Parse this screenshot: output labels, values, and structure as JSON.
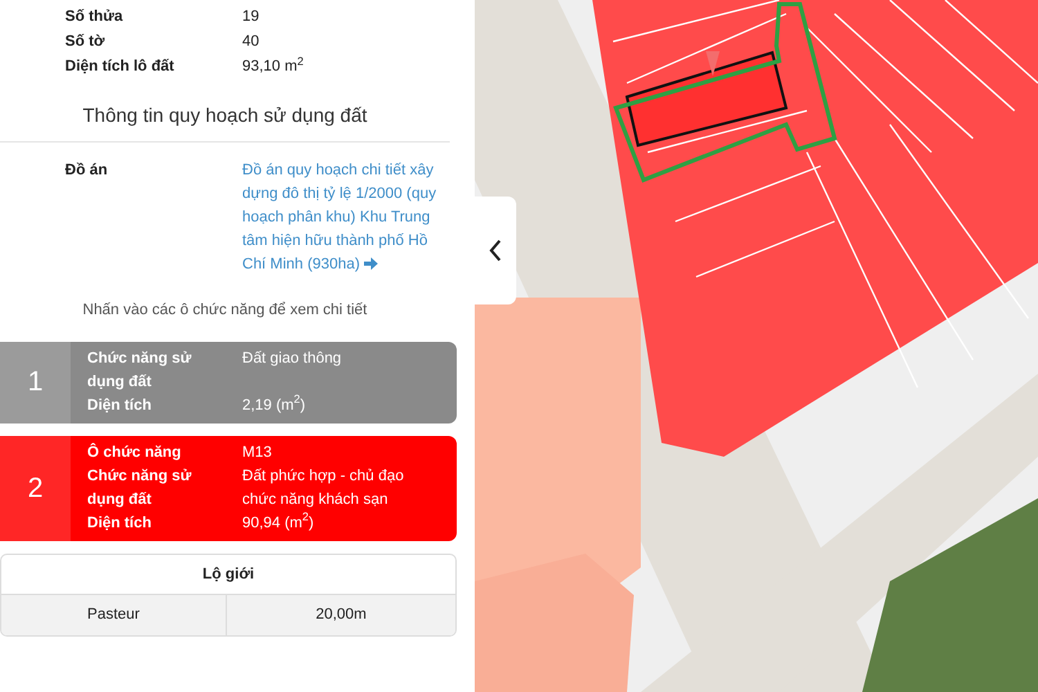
{
  "parcel_info": [
    {
      "label": "Số thửa",
      "value": "19"
    },
    {
      "label": "Số tờ",
      "value": "40"
    },
    {
      "label": "Diện tích lô đất",
      "value": "93,10 m$^{2}$"
    }
  ],
  "planning_title": "Thông tin quy hoạch sử dụng đất",
  "project": {
    "label": "Đồ án",
    "link": "Đồ án quy hoạch chi tiết xây dựng đô thị tỷ lệ 1/2000 (quy hoạch phân khu) Khu Trung tâm hiện hữu thành phố Hồ Chí Minh (930ha)"
  },
  "hint": "Nhấn vào các ô chức năng để xem chi tiết",
  "zones": [
    {
      "number": "1",
      "color": "#8a8a8a",
      "fields": [
        {
          "label": "Chức năng sử dụng đất",
          "value": "Đất giao thông"
        },
        {
          "label": "Diện tích",
          "value": "2,19 (m$^{2}$)"
        }
      ]
    },
    {
      "number": "2",
      "color": "#ff0000",
      "fields": [
        {
          "label": "Ô chức năng",
          "value": "M13"
        },
        {
          "label": "Chức năng sử dụng đất",
          "value": "Đất phức hợp - chủ đạo chức năng khách sạn"
        },
        {
          "label": "Diện tích",
          "value": "90,94 (m$^{2}$)"
        }
      ]
    }
  ],
  "road_width": {
    "title": "Lộ giới",
    "rows": [
      {
        "road": "Pasteur",
        "width": "20,00m"
      }
    ]
  }
}
